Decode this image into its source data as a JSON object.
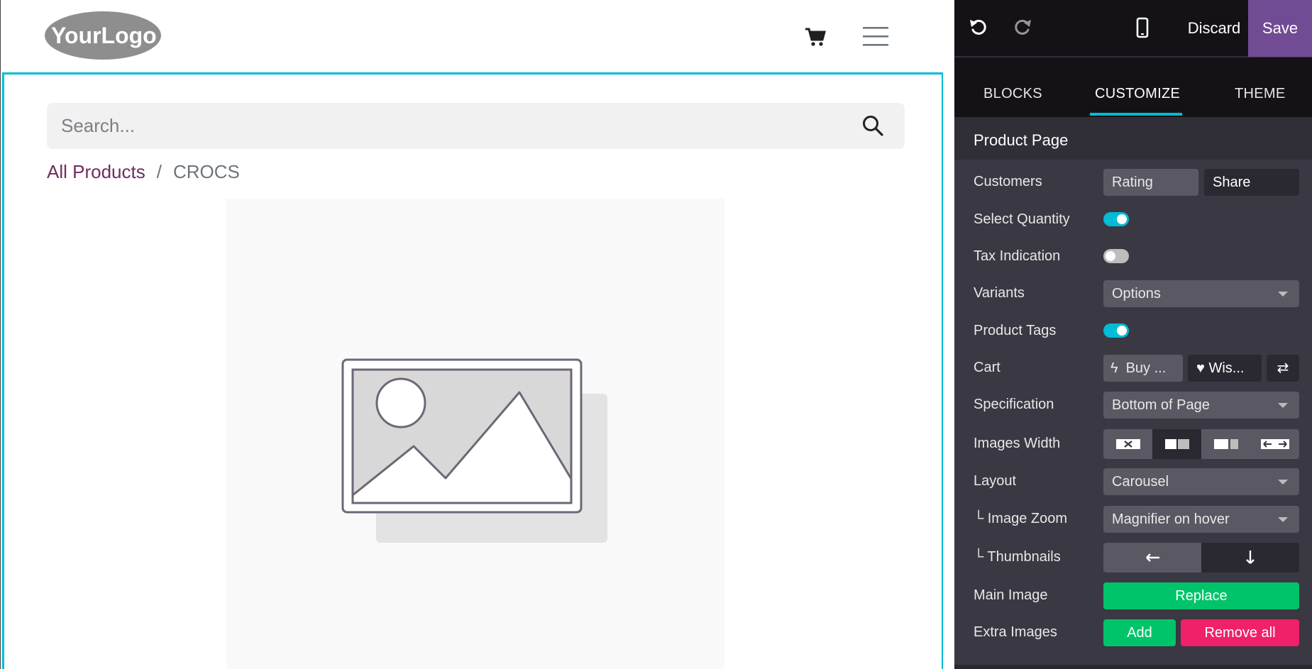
{
  "site": {
    "logo_text": "YourLogo",
    "search_placeholder": "Search...",
    "breadcrumb": {
      "all_products": "All Products",
      "separator": "/",
      "current": "CROCS"
    }
  },
  "editor": {
    "topbar": {
      "discard_label": "Discard",
      "save_label": "Save"
    },
    "tabs": [
      "BLOCKS",
      "CUSTOMIZE",
      "THEME"
    ],
    "active_tab": "CUSTOMIZE",
    "section_title": "Product Page",
    "options": {
      "customers": {
        "label": "Customers",
        "rating": "Rating",
        "share": "Share"
      },
      "select_quantity": {
        "label": "Select Quantity",
        "on": true
      },
      "tax_indication": {
        "label": "Tax Indication",
        "on": false
      },
      "variants": {
        "label": "Variants",
        "value": "Options"
      },
      "product_tags": {
        "label": "Product Tags",
        "on": true
      },
      "cart": {
        "label": "Cart",
        "buy": "Buy ...",
        "wishlist": "Wis..."
      },
      "specification": {
        "label": "Specification",
        "value": "Bottom of Page"
      },
      "images_width": {
        "label": "Images Width"
      },
      "layout": {
        "label": "Layout",
        "value": "Carousel"
      },
      "image_zoom": {
        "label": "└ Image Zoom",
        "value": "Magnifier on hover"
      },
      "thumbnails": {
        "label": "└ Thumbnails"
      },
      "main_image": {
        "label": "Main Image",
        "replace": "Replace"
      },
      "extra_images": {
        "label": "Extra Images",
        "add": "Add",
        "remove_all": "Remove all"
      }
    }
  },
  "colors": {
    "accent": "#00bcd4",
    "save": "#714b94",
    "breadcrumb_link": "#6e2d5f",
    "green": "#00c46a",
    "pink": "#f0216a"
  }
}
